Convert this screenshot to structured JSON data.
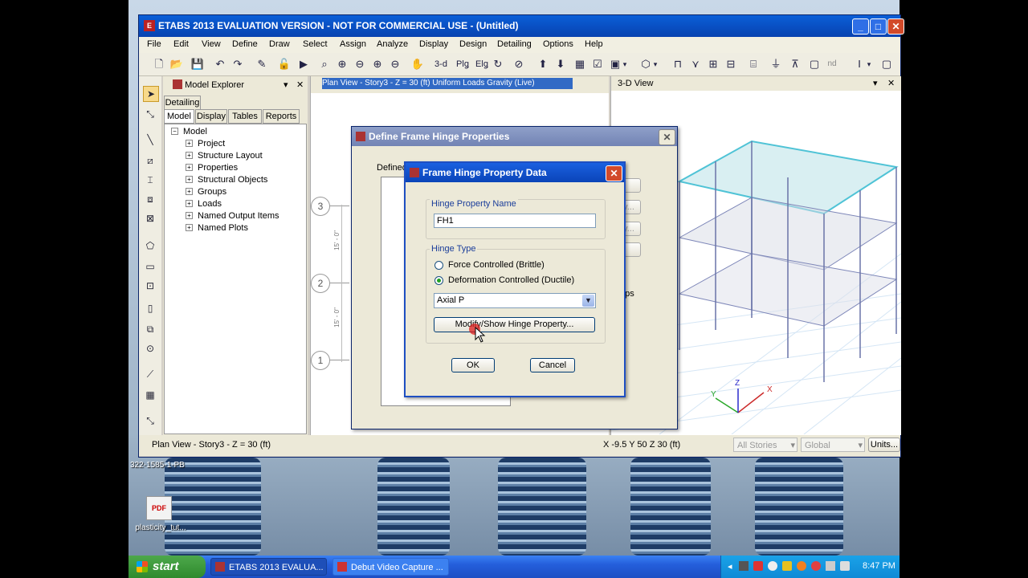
{
  "desktop": {
    "side_text_1": "322-1585-1-PB",
    "side_text_2": "plasticity_tut...",
    "icon_badge": "PDF"
  },
  "window": {
    "title": "ETABS 2013 EVALUATION VERSION - NOT FOR COMMERCIAL USE - (Untitled)",
    "menu": [
      "File",
      "Edit",
      "View",
      "Define",
      "Draw",
      "Select",
      "Assign",
      "Analyze",
      "Display",
      "Design",
      "Detailing",
      "Options",
      "Help"
    ],
    "toolbar_text": {
      "three_d": "3-d",
      "plan": "Plǥ",
      "elev": "Elǥ",
      "nd": "nd"
    }
  },
  "explorer": {
    "title": "Model Explorer",
    "detailing_tab": "Detailing",
    "tabs": [
      "Model",
      "Display",
      "Tables",
      "Reports"
    ],
    "root": "Model",
    "items": [
      "Project",
      "Structure Layout",
      "Properties",
      "Structural Objects",
      "Groups",
      "Loads",
      "Named Output Items",
      "Named Plots"
    ]
  },
  "plan_view": {
    "title": "Plan View - Story3 - Z = 30 (ft)  Uniform Loads Gravity  (Live)",
    "grid_labels": [
      "3",
      "2",
      "1"
    ],
    "dims": [
      "15' - 0\"",
      "15' - 0\""
    ]
  },
  "view3d": {
    "title": "3-D View",
    "axes": {
      "x": "X",
      "y": "Y",
      "z": "Z"
    }
  },
  "define_dialog": {
    "title": "Define Frame Hinge Properties",
    "defined_label": "Defined",
    "partial_text": "ops",
    "partial_btn_1": "y...",
    "partial_btn_2": "y..."
  },
  "hinge_dialog": {
    "title": "Frame Hinge Property Data",
    "name_group": "Hinge Property Name",
    "name_value": "FH1",
    "type_group": "Hinge Type",
    "radio_force": "Force Controlled  (Brittle)",
    "radio_deform": "Deformation Controlled  (Ductile)",
    "selected": "deform",
    "dropdown_value": "Axial P",
    "modify_button": "Modify/Show Hinge Property...",
    "ok": "OK",
    "cancel": "Cancel"
  },
  "status": {
    "left": "Plan View - Story3 - Z = 30 (ft)",
    "coords": "X -9.5  Y 50  Z 30 (ft)",
    "stories": "All Stories",
    "global": "Global",
    "units": "Units..."
  },
  "taskbar": {
    "start": "start",
    "tasks": [
      "ETABS 2013 EVALUA...",
      "Debut Video Capture ..."
    ],
    "clock": "8:47 PM"
  },
  "colors": {
    "titlebar": "#0a5fd8",
    "taskbar": "#245edb",
    "start": "#3c9a3a",
    "tray": "#0f8ad6"
  }
}
